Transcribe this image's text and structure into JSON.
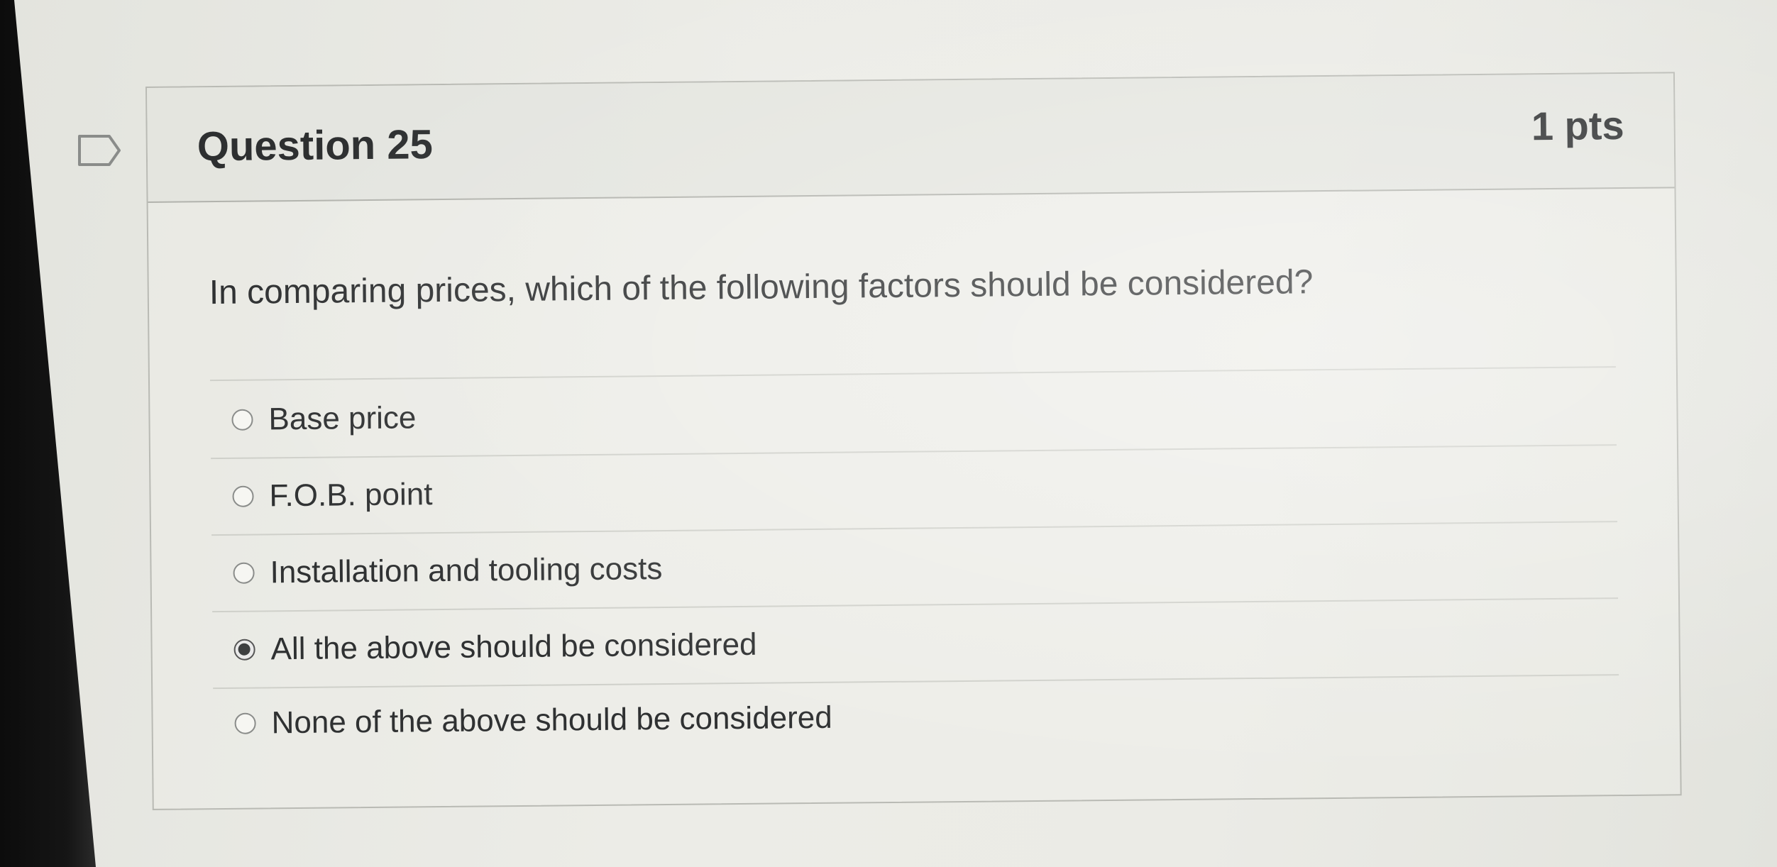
{
  "question": {
    "title": "Question 25",
    "points": "1 pts",
    "text": "In comparing prices, which of the following factors should be considered?",
    "answers": [
      {
        "label": "Base price",
        "selected": false
      },
      {
        "label": "F.O.B. point",
        "selected": false
      },
      {
        "label": "Installation and tooling costs",
        "selected": false
      },
      {
        "label": "All the above should be considered",
        "selected": true
      },
      {
        "label": "None of the above should be considered",
        "selected": false
      }
    ]
  },
  "icons": {
    "flag": "flag-question-icon"
  },
  "colors": {
    "text": "#2d2f30",
    "border": "#b9bab4",
    "radio_selected": "#3d3f40"
  }
}
